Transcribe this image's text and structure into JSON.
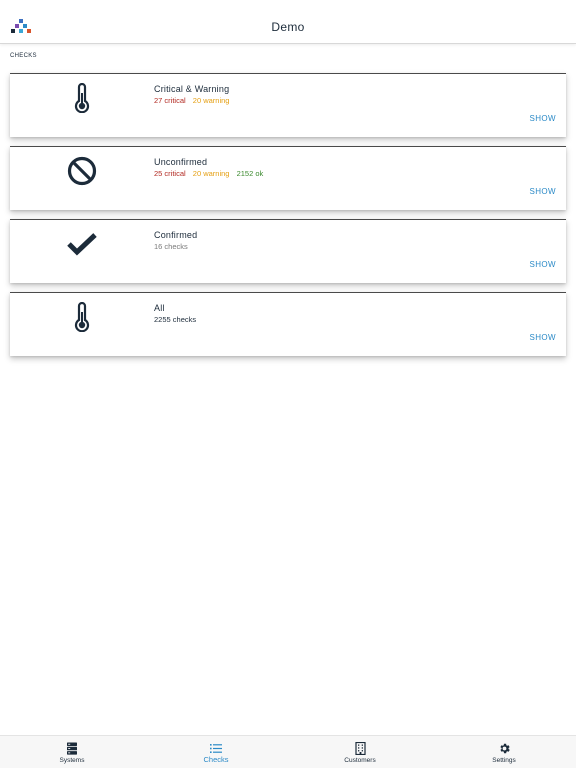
{
  "header": {
    "title": "Demo"
  },
  "section_label": "CHECKS",
  "cards": [
    {
      "title": "Critical & Warning",
      "icon": "thermometer-icon",
      "critical": "27 critical",
      "warning": "20 warning",
      "action": "SHOW"
    },
    {
      "title": "Unconfirmed",
      "icon": "ban-icon",
      "critical": "25 critical",
      "warning": "20 warning",
      "ok": "2152 ok",
      "action": "SHOW"
    },
    {
      "title": "Confirmed",
      "icon": "checkmark-icon",
      "count": "16 checks",
      "action": "SHOW"
    },
    {
      "title": "All",
      "icon": "thermometer-icon",
      "count": "2255 checks",
      "action": "SHOW"
    }
  ],
  "tabs": [
    {
      "label": "Systems",
      "icon": "server-icon"
    },
    {
      "label": "Checks",
      "icon": "list-icon",
      "active": true
    },
    {
      "label": "Customers",
      "icon": "building-icon"
    },
    {
      "label": "Settings",
      "icon": "gear-icon"
    }
  ],
  "colors": {
    "critical": "#b22a22",
    "warning": "#e5a014",
    "ok": "#3b8a2e",
    "accent": "#2b8ac7",
    "navy": "#1c2b3a"
  }
}
